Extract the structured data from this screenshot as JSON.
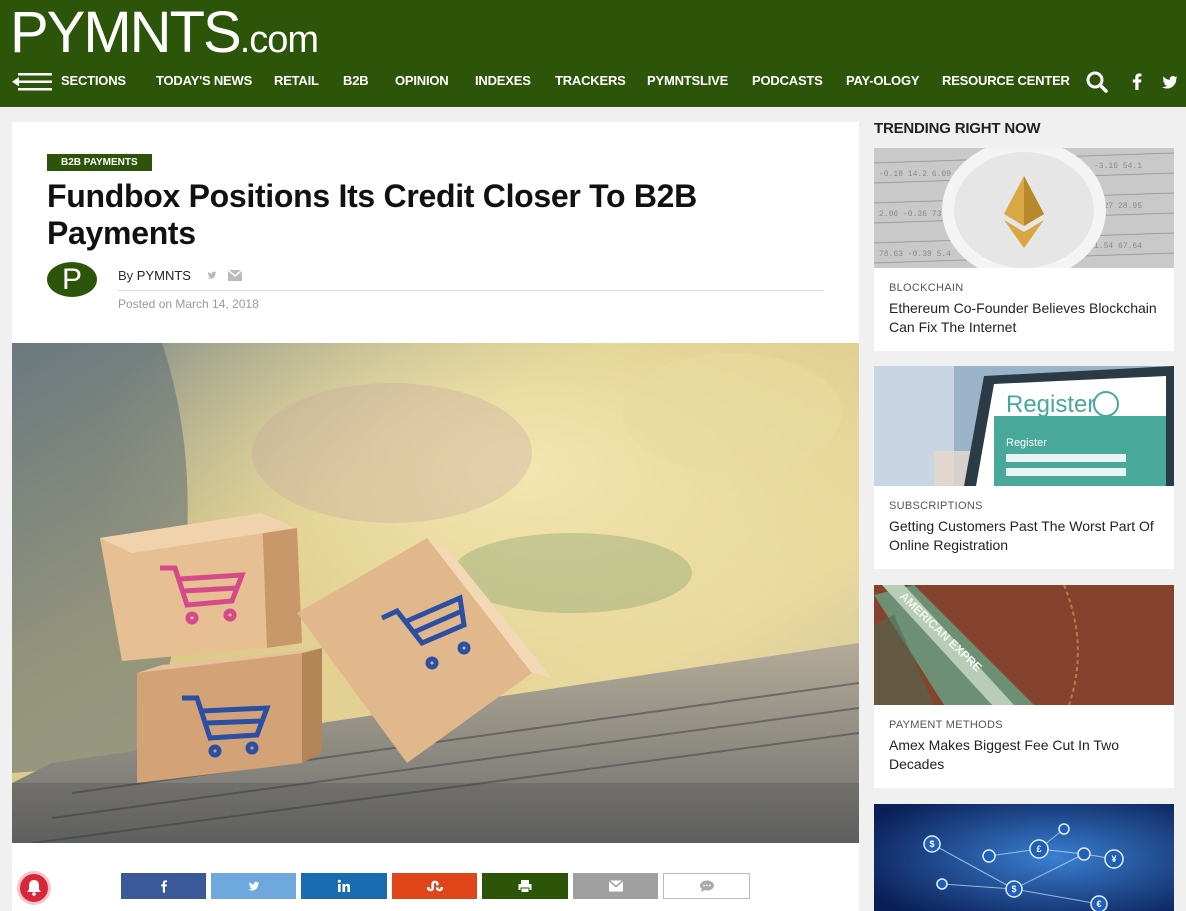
{
  "brand": {
    "logo_main": "PYMNTS",
    "logo_suffix": ".com"
  },
  "nav": {
    "sections": "SECTIONS",
    "items": [
      "TODAY'S NEWS",
      "RETAIL",
      "B2B",
      "OPINION",
      "INDEXES",
      "TRACKERS",
      "PYMNTSLIVE",
      "PODCASTS",
      "PAY-OLOGY",
      "RESOURCE CENTER"
    ]
  },
  "article": {
    "category": "B2B PAYMENTS",
    "title": "Fundbox Positions Its Credit Closer To B2B Payments",
    "avatar_letter": "P",
    "by_label": "By",
    "author": "PYMNTS",
    "posted": "Posted on March 14, 2018"
  },
  "share_buttons": [
    {
      "name": "facebook",
      "color": "#3b5998"
    },
    {
      "name": "twitter",
      "color": "#6fa8dc"
    },
    {
      "name": "linkedin",
      "color": "#1a6bb0"
    },
    {
      "name": "stumbleupon",
      "color": "#e0451a"
    },
    {
      "name": "print",
      "color": "#2c5509"
    },
    {
      "name": "email",
      "color": "#a0a0a0"
    },
    {
      "name": "comment",
      "color": "#ffffff"
    }
  ],
  "sidebar": {
    "heading": "TRENDING RIGHT NOW",
    "cards": [
      {
        "category": "BLOCKCHAIN",
        "headline": "Ethereum Co-Founder Believes Blockchain Can Fix The Internet"
      },
      {
        "category": "SUBSCRIPTIONS",
        "headline": "Getting Customers Past The Worst Part Of Online Registration"
      },
      {
        "category": "PAYMENT METHODS",
        "headline": "Amex Makes Biggest Fee Cut In Two Decades"
      }
    ],
    "register_img_text": "Register",
    "register_img_sub": "Register",
    "amex_img_text": "AMERICAN EXPRE"
  },
  "colors": {
    "brand_green": "#2c5509",
    "notification_red": "#d7283a"
  }
}
